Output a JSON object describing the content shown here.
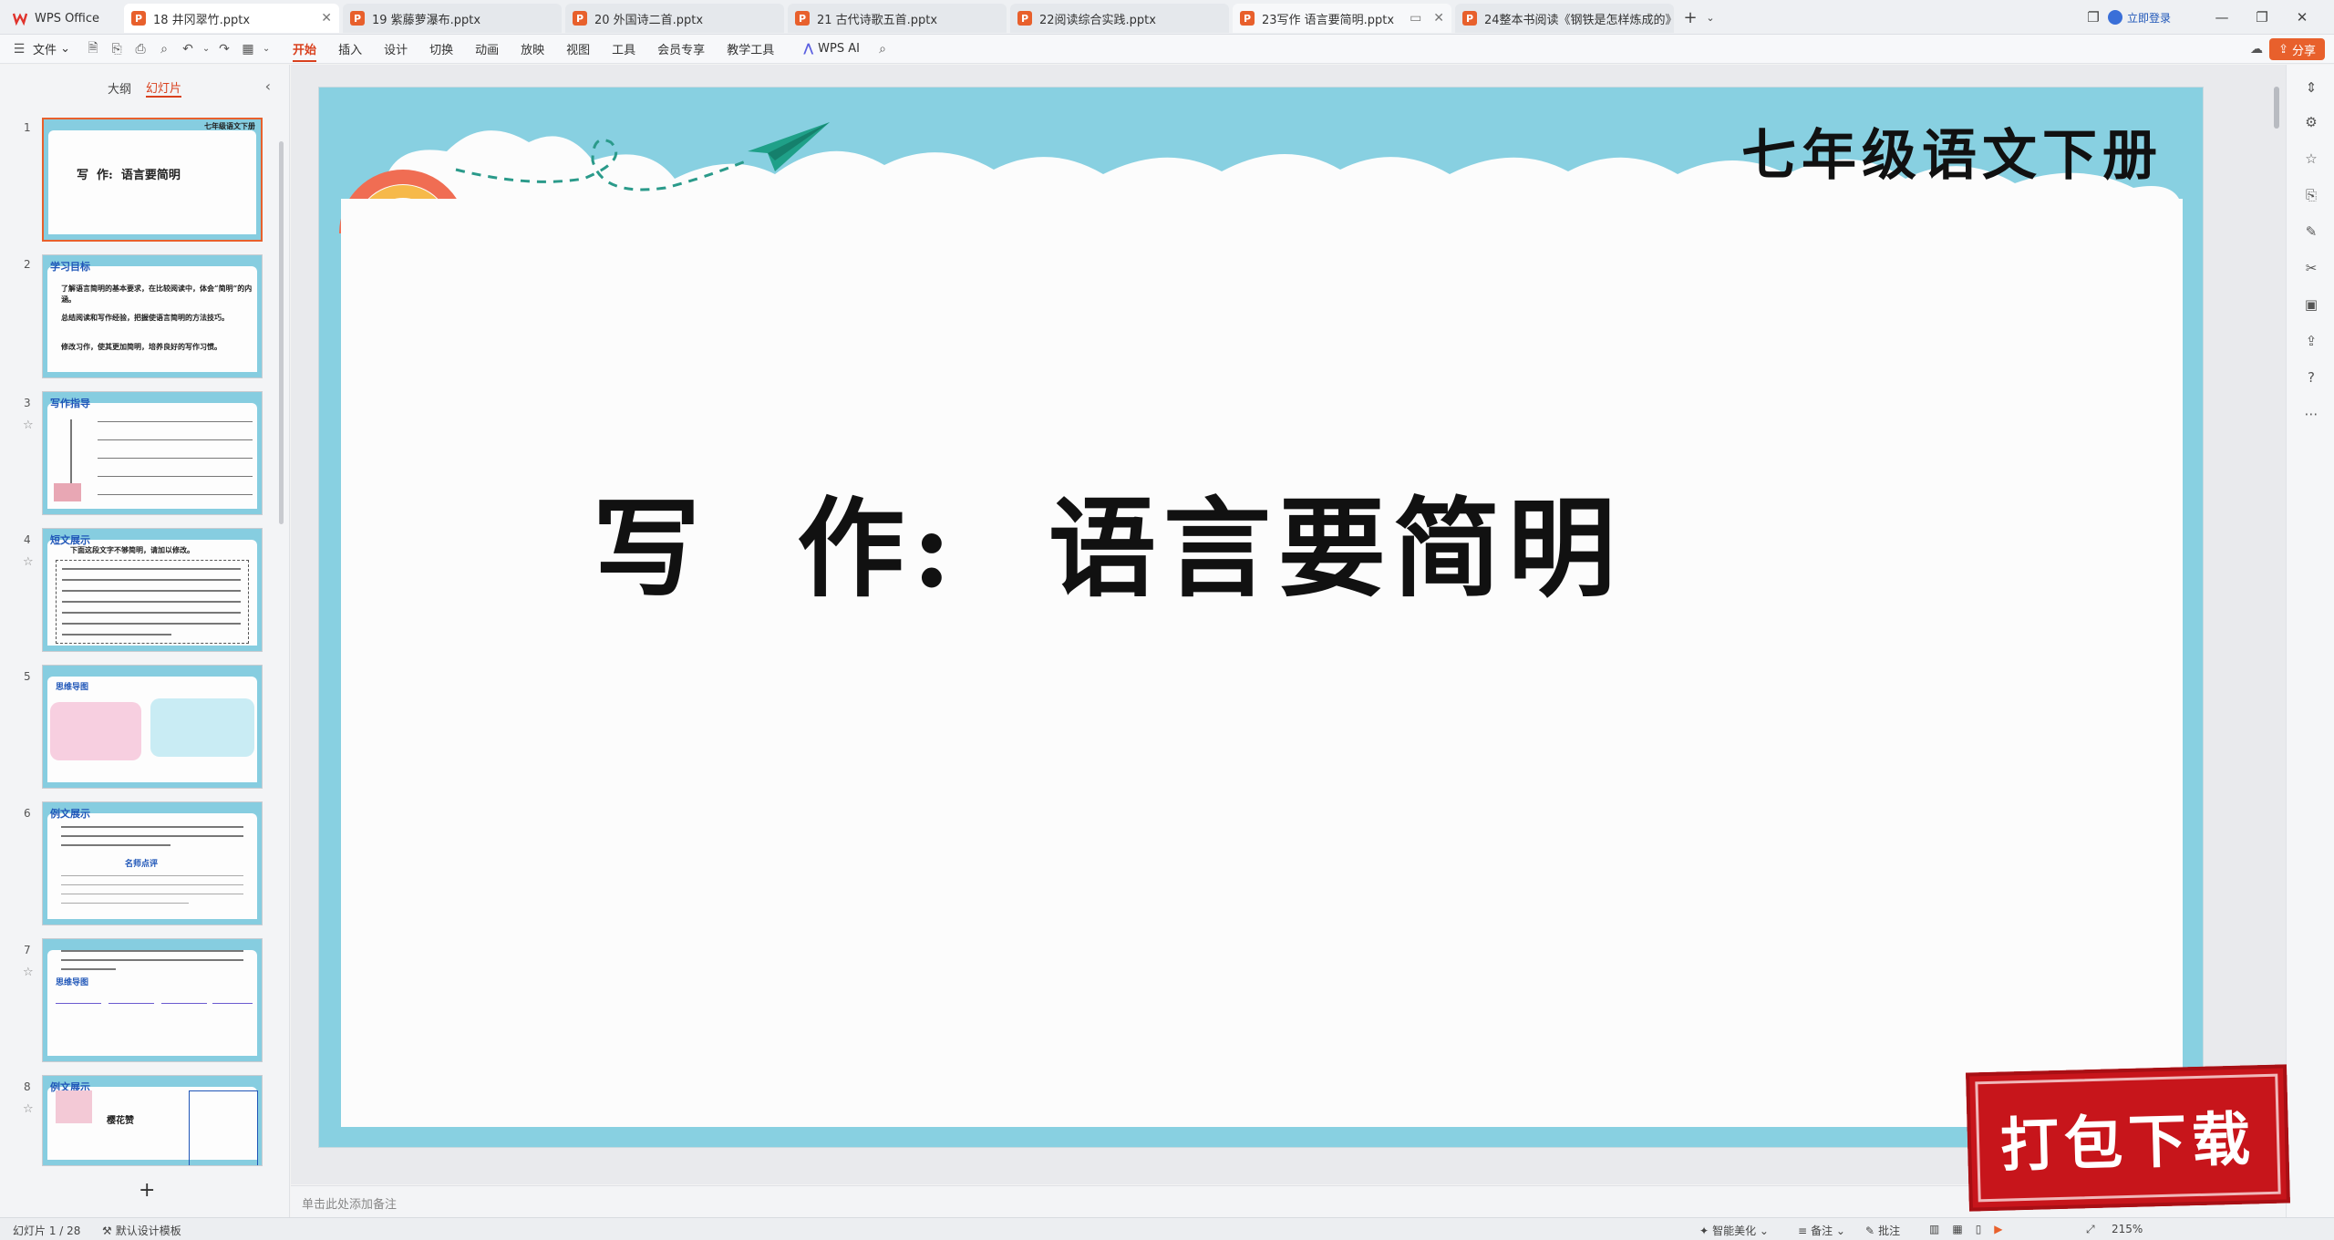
{
  "titlebar": {
    "app_name": "WPS Office",
    "tabs": [
      {
        "label": "18 井冈翠竹.pptx",
        "active": true
      },
      {
        "label": "19 紫藤萝瀑布.pptx"
      },
      {
        "label": "20 外国诗二首.pptx"
      },
      {
        "label": "21 古代诗歌五首.pptx"
      },
      {
        "label": "22阅读综合实践.pptx"
      },
      {
        "label": "23写作 语言要简明.pptx"
      },
      {
        "label": "24整本书阅读《钢铁是怎样炼成的》"
      }
    ],
    "login_label": "立即登录"
  },
  "menubar": {
    "file_label": "文件",
    "items": [
      "开始",
      "插入",
      "设计",
      "切换",
      "动画",
      "放映",
      "视图",
      "工具",
      "会员专享",
      "教学工具"
    ],
    "wps_ai_label": "WPS AI",
    "share_label": "分享"
  },
  "leftpanel": {
    "tab_outline": "大纲",
    "tab_slides": "幻灯片",
    "slides": [
      {
        "num": "1",
        "header": "七年级语文下册",
        "title": "写  作:  语言要简明"
      },
      {
        "num": "2",
        "title": "学习目标",
        "lines": [
          "了解语言简明的基本要求，在比较阅读中，体会“简明”的内涵。",
          "总结阅读和写作经验，把握使语言简明的方法技巧。",
          "修改习作，使其更加简明，培养良好的写作习惯。"
        ]
      },
      {
        "num": "3",
        "title": "写作指导"
      },
      {
        "num": "4",
        "title": "短文展示",
        "lines": [
          "下面这段文字不够简明，请加以修改。"
        ]
      },
      {
        "num": "5",
        "title": "思维导图"
      },
      {
        "num": "6",
        "title": "例文展示",
        "subtitle": "名师点评"
      },
      {
        "num": "7",
        "title": "思维导图"
      },
      {
        "num": "8",
        "title": "例文展示",
        "subtitle": "樱花赞"
      }
    ]
  },
  "slide": {
    "header_title": "七年级语文下册",
    "main_title": "写  作:  语言要简明"
  },
  "notes": {
    "placeholder": "单击此处添加备注"
  },
  "statusbar": {
    "slide_counter": "幻灯片 1 / 28",
    "design_template": "默认设计模板",
    "smart_beautify": "智能美化",
    "notes_label": "备注",
    "comments_label": "批注",
    "zoom": "215%"
  },
  "overlay": {
    "download_label": "打包下载"
  },
  "colors": {
    "accent": "#e8602c",
    "slide_bg": "#88d0e1",
    "badge_red": "#c7151b"
  }
}
